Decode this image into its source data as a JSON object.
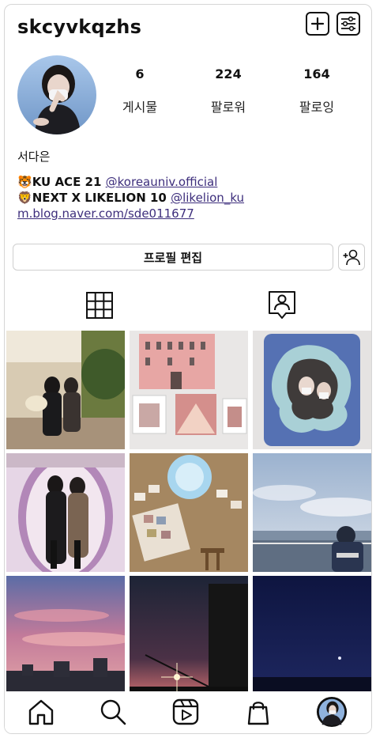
{
  "header": {
    "username": "skcyvkqzhs"
  },
  "profile": {
    "stats": [
      {
        "count": "6",
        "label": "게시물"
      },
      {
        "count": "224",
        "label": "팔로워"
      },
      {
        "count": "164",
        "label": "팔로잉"
      }
    ],
    "name": "서다은",
    "bio_line1_text": "KU ACE 21",
    "bio_line1_mention": "@koreauniv.official",
    "bio_line2_text": "NEXT X LIKELION 10",
    "bio_line2_mention": "@likelion_ku",
    "bio_link": "m.blog.naver.com/sde011677",
    "emoji1": "🐯",
    "emoji2": "🦁"
  },
  "actions": {
    "edit_profile": "프로필 편집"
  },
  "icons": {
    "add": "plus-square-icon",
    "settings": "settings-sliders-icon",
    "add_person": "add-person-icon",
    "grid": "grid-icon",
    "tagged": "tagged-icon",
    "home": "home-icon",
    "search": "search-icon",
    "reels": "reels-icon",
    "shop": "shopping-bag-icon"
  },
  "colors": {
    "link": "#3d2e7c",
    "border": "#cfcfcf"
  }
}
